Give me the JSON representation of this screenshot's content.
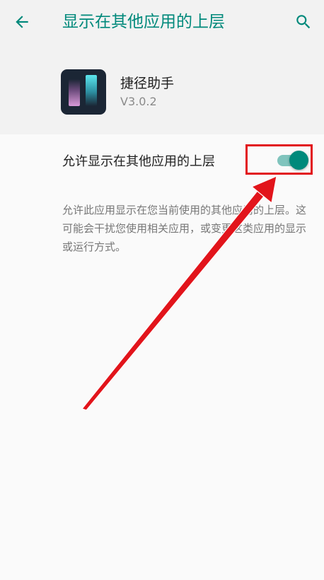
{
  "header": {
    "title": "显示在其他应用的上层",
    "back_icon": "arrow-back-icon",
    "search_icon": "search-icon"
  },
  "app": {
    "name": "捷径助手",
    "version": "V3.0.2",
    "icon": "app-icon"
  },
  "setting": {
    "label": "允许显示在其他应用的上层",
    "toggle_on": true,
    "description": "允许此应用显示在您当前使用的其他应用的上层。这可能会干扰您使用相关应用，或变更这类应用的显示或运行方式。"
  },
  "colors": {
    "accent": "#00897b",
    "toggle_track": "#80c4bd",
    "annotation_red": "#e2141b",
    "header_bg": "#f2f2f2",
    "body_bg": "#fafafa"
  }
}
